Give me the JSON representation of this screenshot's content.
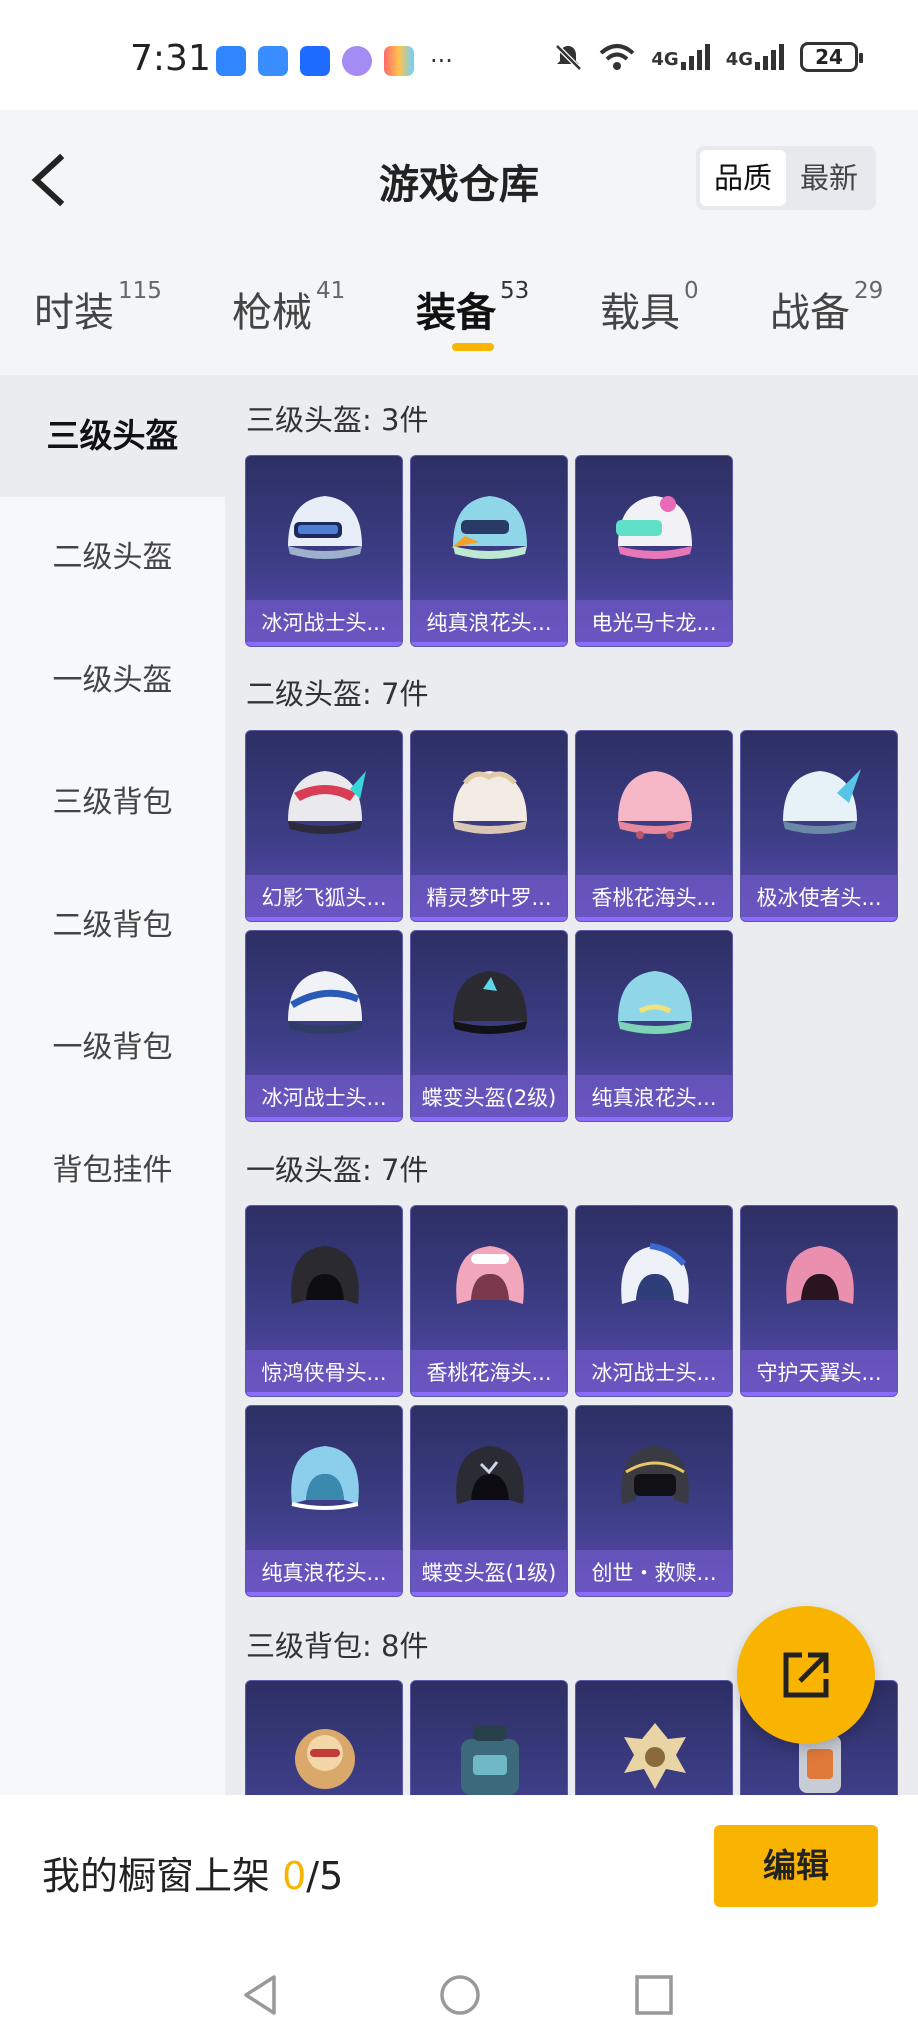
{
  "status_bar": {
    "time": "7:31",
    "network_1": "4G",
    "network_2": "4G",
    "battery": "24"
  },
  "header": {
    "title": "游戏仓库",
    "sort_options": [
      "品质",
      "最新"
    ],
    "active_sort": "品质"
  },
  "tabs": [
    {
      "label": "时装",
      "count": "115"
    },
    {
      "label": "枪械",
      "count": "41"
    },
    {
      "label": "装备",
      "count": "53",
      "active": true
    },
    {
      "label": "载具",
      "count": "0"
    },
    {
      "label": "战备",
      "count": "29"
    }
  ],
  "sidebar": {
    "items": [
      "三级头盔",
      "二级头盔",
      "一级头盔",
      "三级背包",
      "二级背包",
      "一级背包",
      "背包挂件"
    ],
    "active": "三级头盔"
  },
  "sections": [
    {
      "title": "三级头盔: 3件",
      "items": [
        "冰河战士头...",
        "纯真浪花头...",
        "电光马卡龙..."
      ]
    },
    {
      "title": "二级头盔: 7件",
      "items": [
        "幻影飞狐头...",
        "精灵梦叶罗...",
        "香桃花海头...",
        "极冰使者头...",
        "冰河战士头...",
        "蝶变头盔(2级)",
        "纯真浪花头..."
      ]
    },
    {
      "title": "一级头盔: 7件",
      "items": [
        "惊鸿侠骨头...",
        "香桃花海头...",
        "冰河战士头...",
        "守护天翼头...",
        "纯真浪花头...",
        "蝶变头盔(1级)",
        "创世・救赎..."
      ]
    },
    {
      "title": "三级背包: 8件",
      "items": []
    }
  ],
  "bottom": {
    "shelf_label": "我的橱窗上架",
    "shelf_used": "0",
    "shelf_total": "/5",
    "edit_label": "编辑"
  },
  "colors": {
    "accent": "#f8b400",
    "card_bg": "#3d3d86",
    "card_label": "#7a5fd2"
  },
  "icons": [
    "back-arrow-icon",
    "share-icon",
    "nav-back-icon",
    "nav-home-icon",
    "nav-recent-icon"
  ]
}
